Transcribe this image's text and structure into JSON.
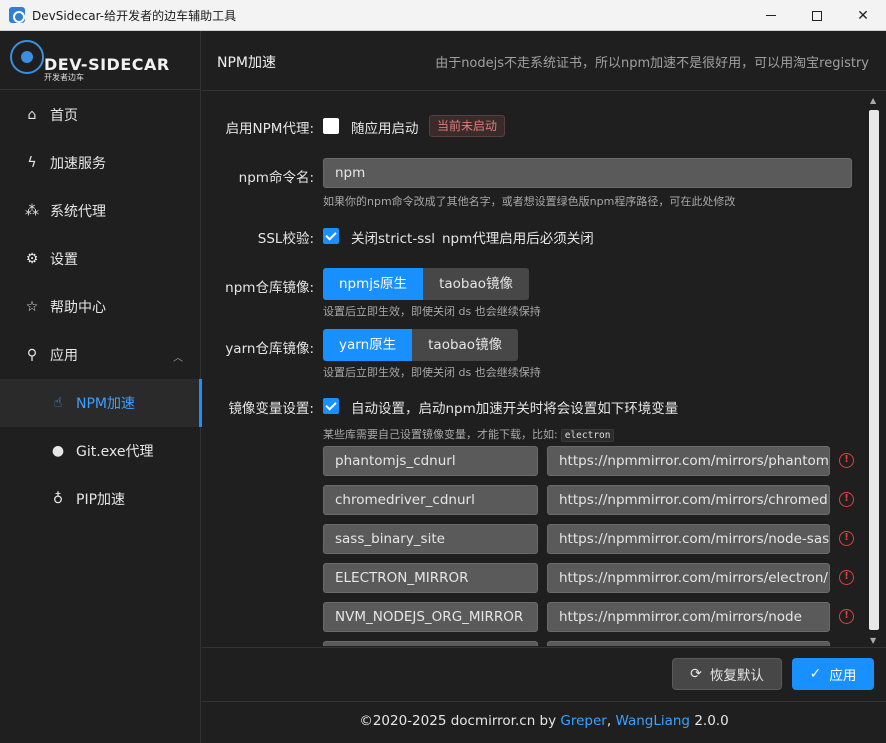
{
  "window": {
    "title": "DevSidecar-给开发者的边车辅助工具"
  },
  "logo": {
    "name": "DEV-SIDECAR",
    "tagline": "开发者边车"
  },
  "sidebar": {
    "items": [
      {
        "label": "首页",
        "icon": "home-icon",
        "glyph": "⌂"
      },
      {
        "label": "加速服务",
        "icon": "lightning-icon",
        "glyph": "ϟ"
      },
      {
        "label": "系统代理",
        "icon": "cluster-icon",
        "glyph": "⁂"
      },
      {
        "label": "设置",
        "icon": "gear-icon",
        "glyph": "⚙"
      },
      {
        "label": "帮助中心",
        "icon": "star-icon",
        "glyph": "☆"
      },
      {
        "label": "应用",
        "icon": "link-icon",
        "glyph": "⚲"
      },
      {
        "label": "NPM加速",
        "icon": "thumbs-up-icon",
        "glyph": "☝"
      },
      {
        "label": "Git.exe代理",
        "icon": "github-icon",
        "glyph": "●"
      },
      {
        "label": "PIP加速",
        "icon": "bulb-icon",
        "glyph": "♁"
      }
    ]
  },
  "header": {
    "title": "NPM加速",
    "note": "由于nodejs不走系统证书，所以npm加速不是很好用，可以用淘宝registry"
  },
  "form": {
    "enable": {
      "label": "启用NPM代理:",
      "checkbox_label": "随应用启动",
      "checked": false,
      "status": "当前未启动"
    },
    "command": {
      "label": "npm命令名:",
      "value": "npm",
      "help": "如果你的npm命令改成了其他名字，或者想设置绿色版npm程序路径，可在此处修改"
    },
    "ssl": {
      "label": "SSL校验:",
      "checked": true,
      "checkbox_label": "关闭strict-ssl",
      "note": "npm代理启用后必须关闭"
    },
    "npm_registry": {
      "label": "npm仓库镜像:",
      "options": [
        "npmjs原生",
        "taobao镜像"
      ],
      "selected": "npmjs原生",
      "help": "设置后立即生效，即使关闭 ds 也会继续保持"
    },
    "yarn_registry": {
      "label": "yarn仓库镜像:",
      "options": [
        "yarn原生",
        "taobao镜像"
      ],
      "selected": "yarn原生",
      "help": "设置后立即生效，即使关闭 ds 也会继续保持"
    },
    "mirror_env": {
      "label": "镜像变量设置:",
      "checked": true,
      "checkbox_label": "自动设置，启动npm加速开关时将会设置如下环境变量",
      "help": "某些库需要自己设置镜像变量，才能下载，比如:",
      "help_code": "electron",
      "vars": [
        {
          "key": "phantomjs_cdnurl",
          "value": "https://npmmirror.com/mirrors/phantomjs"
        },
        {
          "key": "chromedriver_cdnurl",
          "value": "https://npmmirror.com/mirrors/chromedriver"
        },
        {
          "key": "sass_binary_site",
          "value": "https://npmmirror.com/mirrors/node-sass"
        },
        {
          "key": "ELECTRON_MIRROR",
          "value": "https://npmmirror.com/mirrors/electron/"
        },
        {
          "key": "NVM_NODEJS_ORG_MIRROR",
          "value": "https://npmmirror.com/mirrors/node"
        },
        {
          "key": "",
          "value": ""
        }
      ]
    }
  },
  "actions": {
    "reset_label": "恢复默认",
    "apply_label": "应用"
  },
  "footer": {
    "prefix": "©2020-2025 docmirror.cn by ",
    "author1": "Greper",
    "sep": ",",
    "author2": "WangLiang",
    "version": "2.0.0"
  },
  "colors": {
    "accent": "#1890ff",
    "error": "#e34040"
  }
}
